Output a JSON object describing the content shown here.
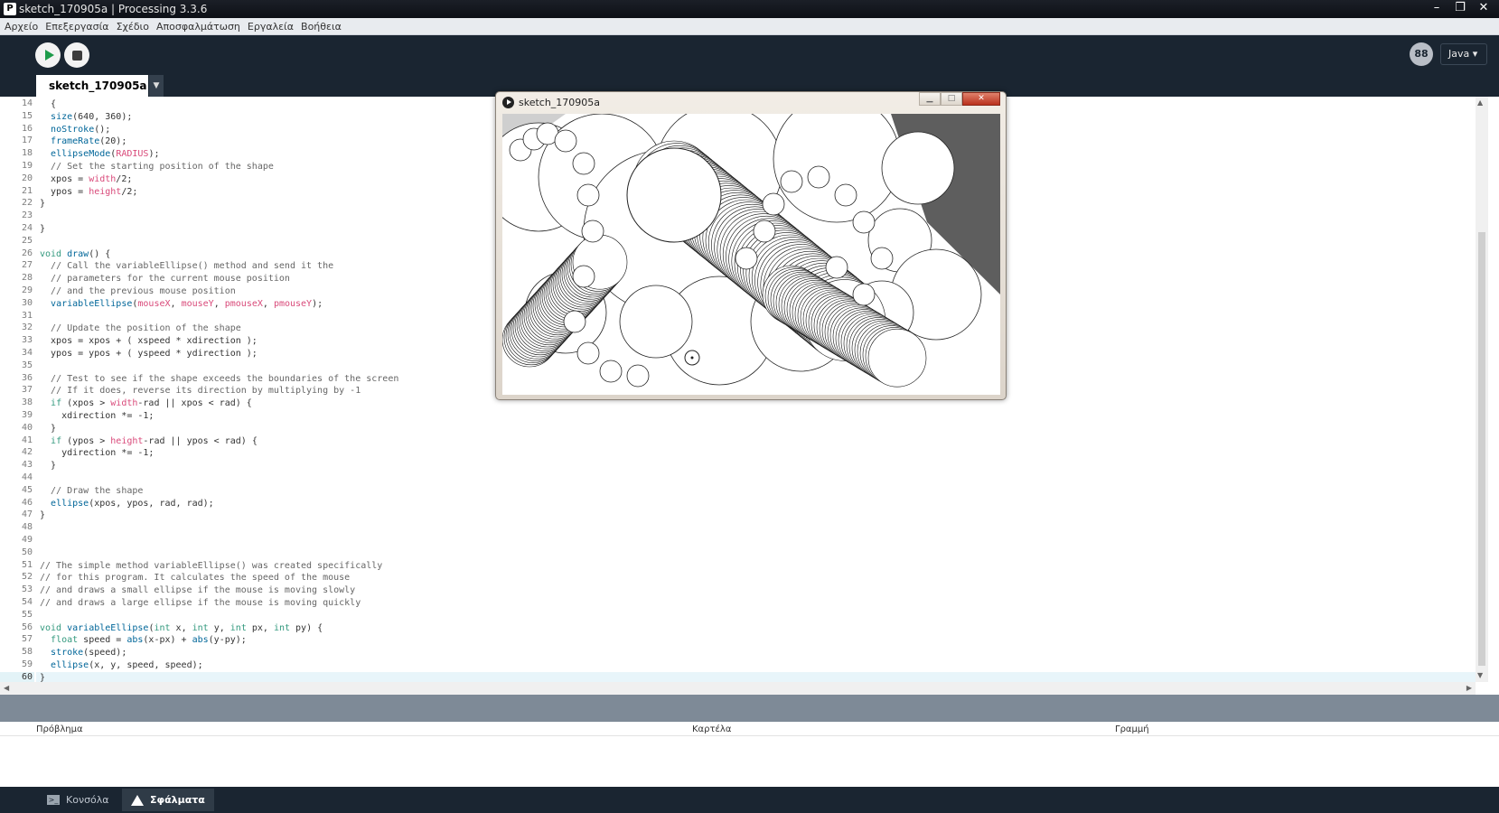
{
  "window": {
    "title": "sketch_170905a | Processing 3.3.6",
    "app_icon": "processing-icon",
    "controls": {
      "minimize": "–",
      "maximize": "❐",
      "close": "✕"
    }
  },
  "menu": [
    "Αρχείο",
    "Επεξεργασία",
    "Σχέδιο",
    "Αποσφαλμάτωση",
    "Εργαλεία",
    "Βοήθεια"
  ],
  "toolbar": {
    "run_icon": "play-icon",
    "stop_icon": "stop-icon",
    "mode_icon_label": "88",
    "mode_label": "Java ▾"
  },
  "tab": {
    "name": "sketch_170905a",
    "menu_glyph": "▼"
  },
  "editor": {
    "current_line": 60,
    "lines": [
      {
        "n": 14,
        "text": "  {"
      },
      {
        "n": 15,
        "text": "  size(640, 360);"
      },
      {
        "n": 16,
        "text": "  noStroke();"
      },
      {
        "n": 17,
        "text": "  frameRate(20);"
      },
      {
        "n": 18,
        "text": "  ellipseMode(RADIUS);"
      },
      {
        "n": 19,
        "text": "  // Set the starting position of the shape"
      },
      {
        "n": 20,
        "text": "  xpos = width/2;"
      },
      {
        "n": 21,
        "text": "  ypos = height/2;"
      },
      {
        "n": 22,
        "text": "}"
      },
      {
        "n": 23,
        "text": ""
      },
      {
        "n": 24,
        "text": "}"
      },
      {
        "n": 25,
        "text": ""
      },
      {
        "n": 26,
        "text": "void draw() {"
      },
      {
        "n": 27,
        "text": "  // Call the variableEllipse() method and send it the"
      },
      {
        "n": 28,
        "text": "  // parameters for the current mouse position"
      },
      {
        "n": 29,
        "text": "  // and the previous mouse position"
      },
      {
        "n": 30,
        "text": "  variableEllipse(mouseX, mouseY, pmouseX, pmouseY);"
      },
      {
        "n": 31,
        "text": ""
      },
      {
        "n": 32,
        "text": "  // Update the position of the shape"
      },
      {
        "n": 33,
        "text": "  xpos = xpos + ( xspeed * xdirection );"
      },
      {
        "n": 34,
        "text": "  ypos = ypos + ( yspeed * ydirection );"
      },
      {
        "n": 35,
        "text": ""
      },
      {
        "n": 36,
        "text": "  // Test to see if the shape exceeds the boundaries of the screen"
      },
      {
        "n": 37,
        "text": "  // If it does, reverse its direction by multiplying by -1"
      },
      {
        "n": 38,
        "text": "  if (xpos > width-rad || xpos < rad) {"
      },
      {
        "n": 39,
        "text": "    xdirection *= -1;"
      },
      {
        "n": 40,
        "text": "  }"
      },
      {
        "n": 41,
        "text": "  if (ypos > height-rad || ypos < rad) {"
      },
      {
        "n": 42,
        "text": "    ydirection *= -1;"
      },
      {
        "n": 43,
        "text": "  }"
      },
      {
        "n": 44,
        "text": ""
      },
      {
        "n": 45,
        "text": "  // Draw the shape"
      },
      {
        "n": 46,
        "text": "  ellipse(xpos, ypos, rad, rad);"
      },
      {
        "n": 47,
        "text": "}"
      },
      {
        "n": 48,
        "text": ""
      },
      {
        "n": 49,
        "text": ""
      },
      {
        "n": 50,
        "text": ""
      },
      {
        "n": 51,
        "text": "// The simple method variableEllipse() was created specifically"
      },
      {
        "n": 52,
        "text": "// for this program. It calculates the speed of the mouse"
      },
      {
        "n": 53,
        "text": "// and draws a small ellipse if the mouse is moving slowly"
      },
      {
        "n": 54,
        "text": "// and draws a large ellipse if the mouse is moving quickly"
      },
      {
        "n": 55,
        "text": ""
      },
      {
        "n": 56,
        "text": "void variableEllipse(int x, int y, int px, int py) {"
      },
      {
        "n": 57,
        "text": "  float speed = abs(x-px) + abs(y-py);"
      },
      {
        "n": 58,
        "text": "  stroke(speed);"
      },
      {
        "n": 59,
        "text": "  ellipse(x, y, speed, speed);"
      },
      {
        "n": 60,
        "text": "}"
      }
    ]
  },
  "problems": {
    "columns": [
      "Πρόβλημα",
      "Καρτέλα",
      "Γραμμή"
    ]
  },
  "footer": {
    "console_label": "Κονσόλα",
    "errors_label": "Σφάλματα",
    "console_icon": "console-icon",
    "errors_icon": "warning-icon"
  },
  "sketch_window": {
    "title": "sketch_170905a",
    "controls": {
      "minimize": "▁",
      "maximize": "□",
      "close": "✕"
    }
  },
  "colors": {
    "keyword": "#33997e",
    "function": "#006699",
    "constant": "#d94a7a",
    "comment": "#666666",
    "toolbar_bg": "#1a2531"
  }
}
